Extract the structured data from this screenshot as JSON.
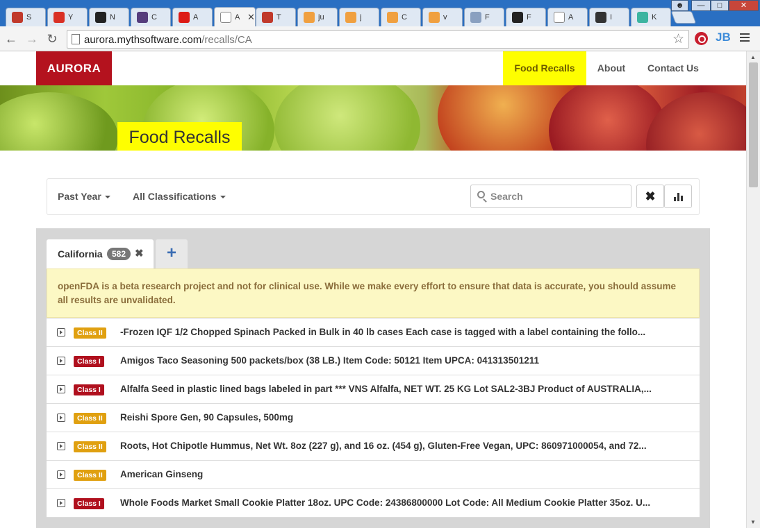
{
  "browser": {
    "tabs": [
      {
        "title": "S",
        "color": "#c0392b"
      },
      {
        "title": "Y",
        "color": "#d93025"
      },
      {
        "title": "N",
        "color": "#222222"
      },
      {
        "title": "C",
        "color": "#563d7c"
      },
      {
        "title": "A",
        "color": "#dd1b16"
      },
      {
        "title": "A",
        "color": "#ffffff",
        "active": true
      },
      {
        "title": "T",
        "color": "#c0392b"
      },
      {
        "title": "ju",
        "color": "#f0a040"
      },
      {
        "title": "j",
        "color": "#f0a040"
      },
      {
        "title": "C",
        "color": "#f0a040"
      },
      {
        "title": "v",
        "color": "#f0a040"
      },
      {
        "title": "F",
        "color": "#8aa0c0"
      },
      {
        "title": "F",
        "color": "#222222"
      },
      {
        "title": "A",
        "color": "#ffffff"
      },
      {
        "title": "I",
        "color": "#333333"
      },
      {
        "title": "K",
        "color": "#3cb4a0"
      }
    ],
    "url_host": "aurora.mythsoftware.com",
    "url_path": "/recalls/CA",
    "extensions": [
      "lastpass-icon",
      "jetbrains-icon"
    ]
  },
  "navbar": {
    "brand": "AURORA",
    "links": [
      {
        "label": "Food Recalls",
        "active": true
      },
      {
        "label": "About",
        "active": false
      },
      {
        "label": "Contact Us",
        "active": false
      }
    ]
  },
  "hero": {
    "title": "Food Recalls"
  },
  "filters": {
    "period": "Past Year",
    "classification": "All Classifications",
    "search_placeholder": "Search",
    "clear_icon": "times-icon",
    "chart_icon": "bar-chart-icon"
  },
  "state_tab": {
    "name": "California",
    "count": "582",
    "close": "✖",
    "add": "+"
  },
  "alert": "openFDA is a beta research project and not for clinical use. While we make every effort to ensure that data is accurate, you should assume all results are unvalidated.",
  "recalls": [
    {
      "classification": "Class II",
      "level": "c2",
      "text": "-Frozen IQF 1/2 Chopped Spinach Packed in Bulk in 40 lb cases Each case is tagged with a label containing the follo..."
    },
    {
      "classification": "Class I",
      "level": "c1",
      "text": "Amigos Taco Seasoning 500 packets/box (38 LB.) Item Code: 50121 Item UPCA: 041313501211"
    },
    {
      "classification": "Class I",
      "level": "c1",
      "text": "Alfalfa Seed in plastic lined bags labeled in part *** VNS Alfalfa, NET WT. 25 KG Lot SAL2-3BJ Product of AUSTRALIA,..."
    },
    {
      "classification": "Class II",
      "level": "c2",
      "text": "Reishi Spore Gen, 90 Capsules, 500mg"
    },
    {
      "classification": "Class II",
      "level": "c2",
      "text": "Roots, Hot Chipotle Hummus, Net Wt. 8oz (227 g), and 16 oz. (454 g), Gluten-Free Vegan, UPC: 860971000054, and 72..."
    },
    {
      "classification": "Class II",
      "level": "c2",
      "text": "American Ginseng"
    },
    {
      "classification": "Class I",
      "level": "c1",
      "text": "Whole Foods Market Small Cookie Platter 18oz. UPC Code: 24386800000 Lot Code: All Medium Cookie Platter 35oz. U..."
    }
  ]
}
